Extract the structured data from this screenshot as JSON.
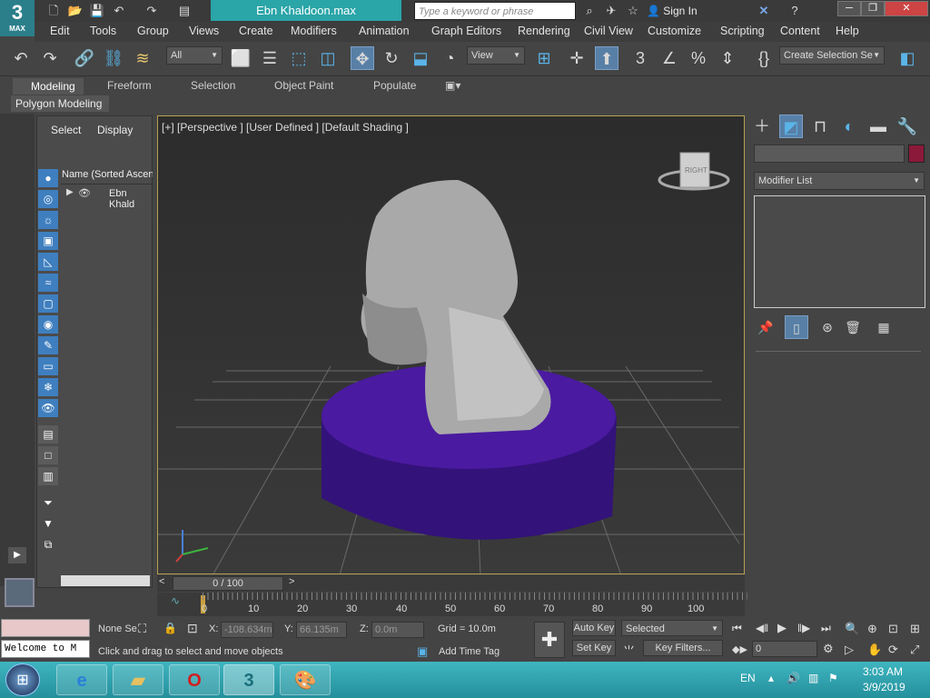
{
  "app": {
    "logo": "3",
    "logo_sub": "MAX",
    "doc_title": "Ebn Khaldoon.max",
    "search_placeholder": "Type a keyword or phrase",
    "sign_in": "Sign In"
  },
  "menu": [
    "Edit",
    "Tools",
    "Group",
    "Views",
    "Create",
    "Modifiers",
    "Animation",
    "Graph Editors",
    "Rendering",
    "Civil View",
    "Customize",
    "Scripting",
    "Content",
    "Help"
  ],
  "toolbar": {
    "filter_value": "All",
    "coord_value": "View",
    "selection_set": "Create Selection Se"
  },
  "ribbon": {
    "tabs": [
      "Modeling",
      "Freeform",
      "Selection",
      "Object Paint",
      "Populate"
    ],
    "sub": "Polygon Modeling"
  },
  "scene_explorer": {
    "tabs": [
      "Select",
      "Display"
    ],
    "column": "Name (Sorted Ascen",
    "item": "Ebn Khald"
  },
  "viewport": {
    "label": "[+] [Perspective ] [User Defined ] [Default Shading ]",
    "viewcube": "RIGHT"
  },
  "command_panel": {
    "modifier_list": "Modifier List",
    "accent": "#8b1a3a"
  },
  "timeline": {
    "frame": "0 / 100",
    "ticks": [
      "0",
      "10",
      "20",
      "30",
      "40",
      "50",
      "60",
      "70",
      "80",
      "90",
      "100"
    ]
  },
  "status": {
    "selection": "None Se",
    "x_label": "X:",
    "x": "-108.634m",
    "y_label": "Y:",
    "y": "66.135m",
    "z_label": "Z:",
    "z": "0.0m",
    "grid": "Grid = 10.0m",
    "prompt": "Click and drag to select and move objects",
    "add_time_tag": "Add Time Tag",
    "maxscript": "Welcome to M",
    "auto_key": "Auto Key",
    "set_key": "Set Key",
    "key_mode": "Selected",
    "key_filters": "Key Filters...",
    "frame_field": "0"
  },
  "taskbar": {
    "lang": "EN",
    "time": "3:03 AM",
    "date": "3/9/2019"
  },
  "colors": {
    "base": "#4a1aa0",
    "sculpt": "#a9a9a9",
    "taskbar": "#2aa5a8"
  }
}
